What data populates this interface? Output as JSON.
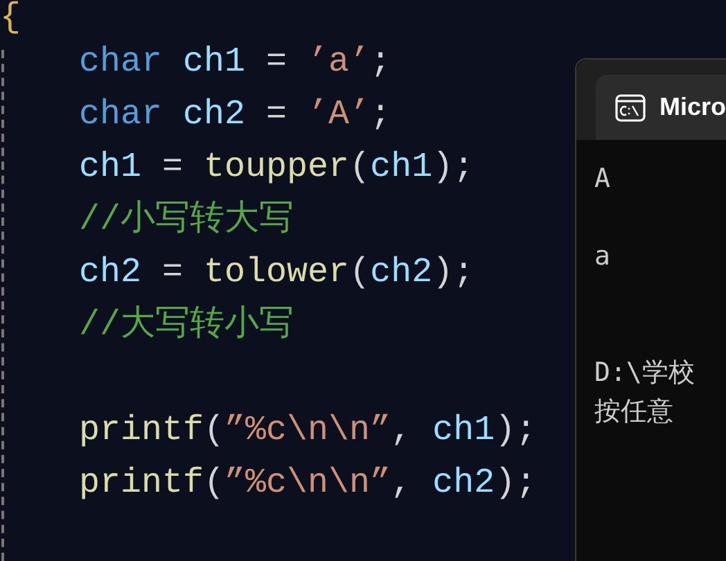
{
  "editor": {
    "brace": "{",
    "blocks": [
      [
        [
          {
            "kind": "keyword",
            "text": "char"
          },
          {
            "kind": "variable",
            "text": "ch1"
          },
          {
            "kind": "plain",
            "text": " = "
          },
          {
            "kind": "string",
            "text": "’a’"
          },
          {
            "kind": "plain",
            "text": ";"
          }
        ],
        [
          {
            "kind": "keyword",
            "text": "char"
          },
          {
            "kind": "variable",
            "text": "ch2"
          },
          {
            "kind": "plain",
            "text": " = "
          },
          {
            "kind": "string",
            "text": "’A’"
          },
          {
            "kind": "plain",
            "text": ";"
          }
        ],
        [
          {
            "kind": "variable",
            "text": "ch1"
          },
          {
            "kind": "plain",
            "text": " = "
          },
          {
            "kind": "function",
            "text": "toupper"
          },
          {
            "kind": "plain",
            "text": "("
          },
          {
            "kind": "variable",
            "text": "ch1"
          },
          {
            "kind": "plain",
            "text": ");"
          }
        ],
        [
          {
            "kind": "comment",
            "text": "//小写转大写"
          }
        ],
        [
          {
            "kind": "variable",
            "text": "ch2"
          },
          {
            "kind": "plain",
            "text": " = "
          },
          {
            "kind": "function",
            "text": "tolower"
          },
          {
            "kind": "plain",
            "text": "("
          },
          {
            "kind": "variable",
            "text": "ch2"
          },
          {
            "kind": "plain",
            "text": ");"
          }
        ],
        [
          {
            "kind": "comment",
            "text": "//大写转小写"
          }
        ]
      ],
      [
        [
          {
            "kind": "function",
            "text": "printf"
          },
          {
            "kind": "plain",
            "text": "("
          },
          {
            "kind": "string",
            "text": "”%c\\n\\n”"
          },
          {
            "kind": "plain",
            "text": ", "
          },
          {
            "kind": "variable",
            "text": "ch1"
          },
          {
            "kind": "plain",
            "text": ");"
          }
        ],
        [
          {
            "kind": "function",
            "text": "printf"
          },
          {
            "kind": "plain",
            "text": "("
          },
          {
            "kind": "string",
            "text": "”%c\\n\\n”"
          },
          {
            "kind": "plain",
            "text": ", "
          },
          {
            "kind": "variable",
            "text": "ch2"
          },
          {
            "kind": "plain",
            "text": ");"
          }
        ]
      ]
    ]
  },
  "terminal": {
    "tab_title": "Micro",
    "output_groups": [
      [
        "A"
      ],
      [
        "a"
      ],
      [
        "D:\\学校",
        "按任意"
      ]
    ]
  }
}
